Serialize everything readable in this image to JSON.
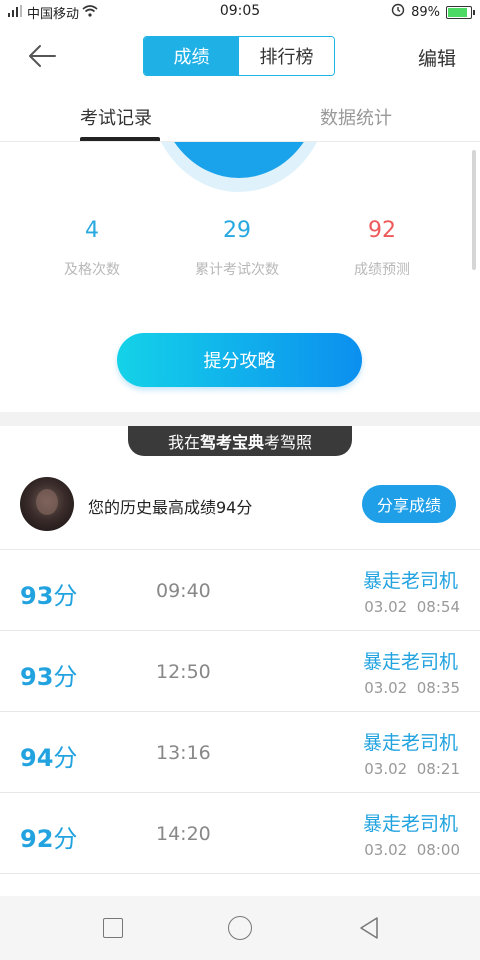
{
  "status_bar": {
    "carrier": "中国移动",
    "time": "09:05",
    "battery": "89%"
  },
  "nav": {
    "segments": [
      "成绩",
      "排行榜"
    ],
    "active_segment": 0,
    "edit_label": "编辑"
  },
  "tabs": [
    "考试记录",
    "数据统计"
  ],
  "stats": [
    {
      "value": "4",
      "label": "及格次数"
    },
    {
      "value": "29",
      "label": "累计考试次数"
    },
    {
      "value": "92",
      "label": "成绩预测"
    }
  ],
  "tips_button": "提分攻略",
  "banner": {
    "prefix": "我在",
    "brand": "驾考宝典",
    "suffix": "考驾照"
  },
  "best": {
    "text": "您的历史最高成绩94分",
    "share_label": "分享成绩"
  },
  "records": [
    {
      "score": "93",
      "unit": "分",
      "duration": "09:40",
      "nickname": "暴走老司机",
      "date": "03.02",
      "time": "08:54"
    },
    {
      "score": "93",
      "unit": "分",
      "duration": "12:50",
      "nickname": "暴走老司机",
      "date": "03.02",
      "time": "08:35"
    },
    {
      "score": "94",
      "unit": "分",
      "duration": "13:16",
      "nickname": "暴走老司机",
      "date": "03.02",
      "time": "08:21"
    },
    {
      "score": "92",
      "unit": "分",
      "duration": "14:20",
      "nickname": "暴走老司机",
      "date": "03.02",
      "time": "08:00"
    }
  ],
  "colors": {
    "accent": "#1fb0e6",
    "score_blue": "#22a3e0",
    "stat_red": "#ee5a5a",
    "banner_bg": "#3a3a3a"
  }
}
